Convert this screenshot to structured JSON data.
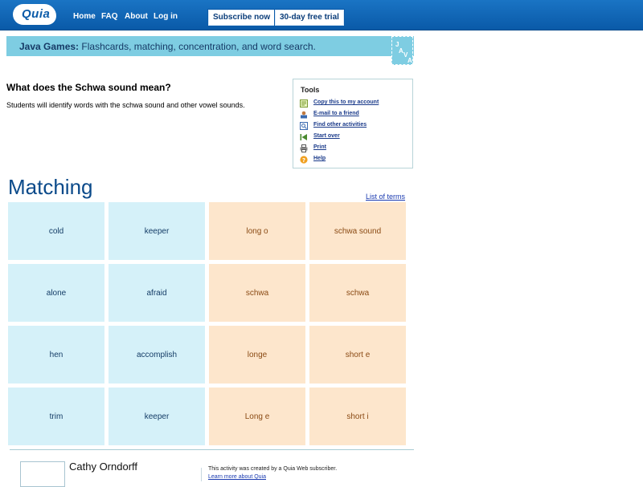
{
  "nav": {
    "logo_text": "Quia",
    "links": [
      "Home",
      "FAQ",
      "About",
      "Log in"
    ],
    "subscribe_label": "Subscribe now",
    "trial_label": "30-day free trial"
  },
  "banner": {
    "bold": "Java Games:",
    "text": " Flashcards, matching, concentration, and word search.",
    "badge_letters": [
      "J",
      "A",
      "V",
      "A"
    ]
  },
  "activity": {
    "title": "What does the Schwa sound mean?",
    "description": "Students will identify words with the schwa sound and other vowel sounds."
  },
  "tools": {
    "title": "Tools",
    "items": [
      {
        "label": "Copy this to my account",
        "icon": "copy-icon"
      },
      {
        "label": "E-mail to a friend",
        "icon": "email-icon"
      },
      {
        "label": "Find other activities",
        "icon": "find-icon"
      },
      {
        "label": "Start over",
        "icon": "start-over-icon"
      },
      {
        "label": "Print",
        "icon": "print-icon"
      },
      {
        "label": "Help",
        "icon": "help-icon"
      }
    ]
  },
  "matching": {
    "title": "Matching",
    "list_of_terms": "List of terms",
    "rows": [
      [
        "cold",
        "keeper",
        "long o",
        "schwa sound"
      ],
      [
        "alone",
        "afraid",
        "schwa",
        "schwa"
      ],
      [
        "hen",
        "accomplish",
        "longe",
        "short e"
      ],
      [
        "trim",
        "keeper",
        "Long e",
        "short i"
      ]
    ],
    "colors": {
      "term": "#d5f1f9",
      "definition": "#fde6cc"
    }
  },
  "footer": {
    "author": "Cathy Orndorff",
    "credit": "This activity was created by a Quia Web subscriber.",
    "learn_more": "Learn more about Quia"
  }
}
